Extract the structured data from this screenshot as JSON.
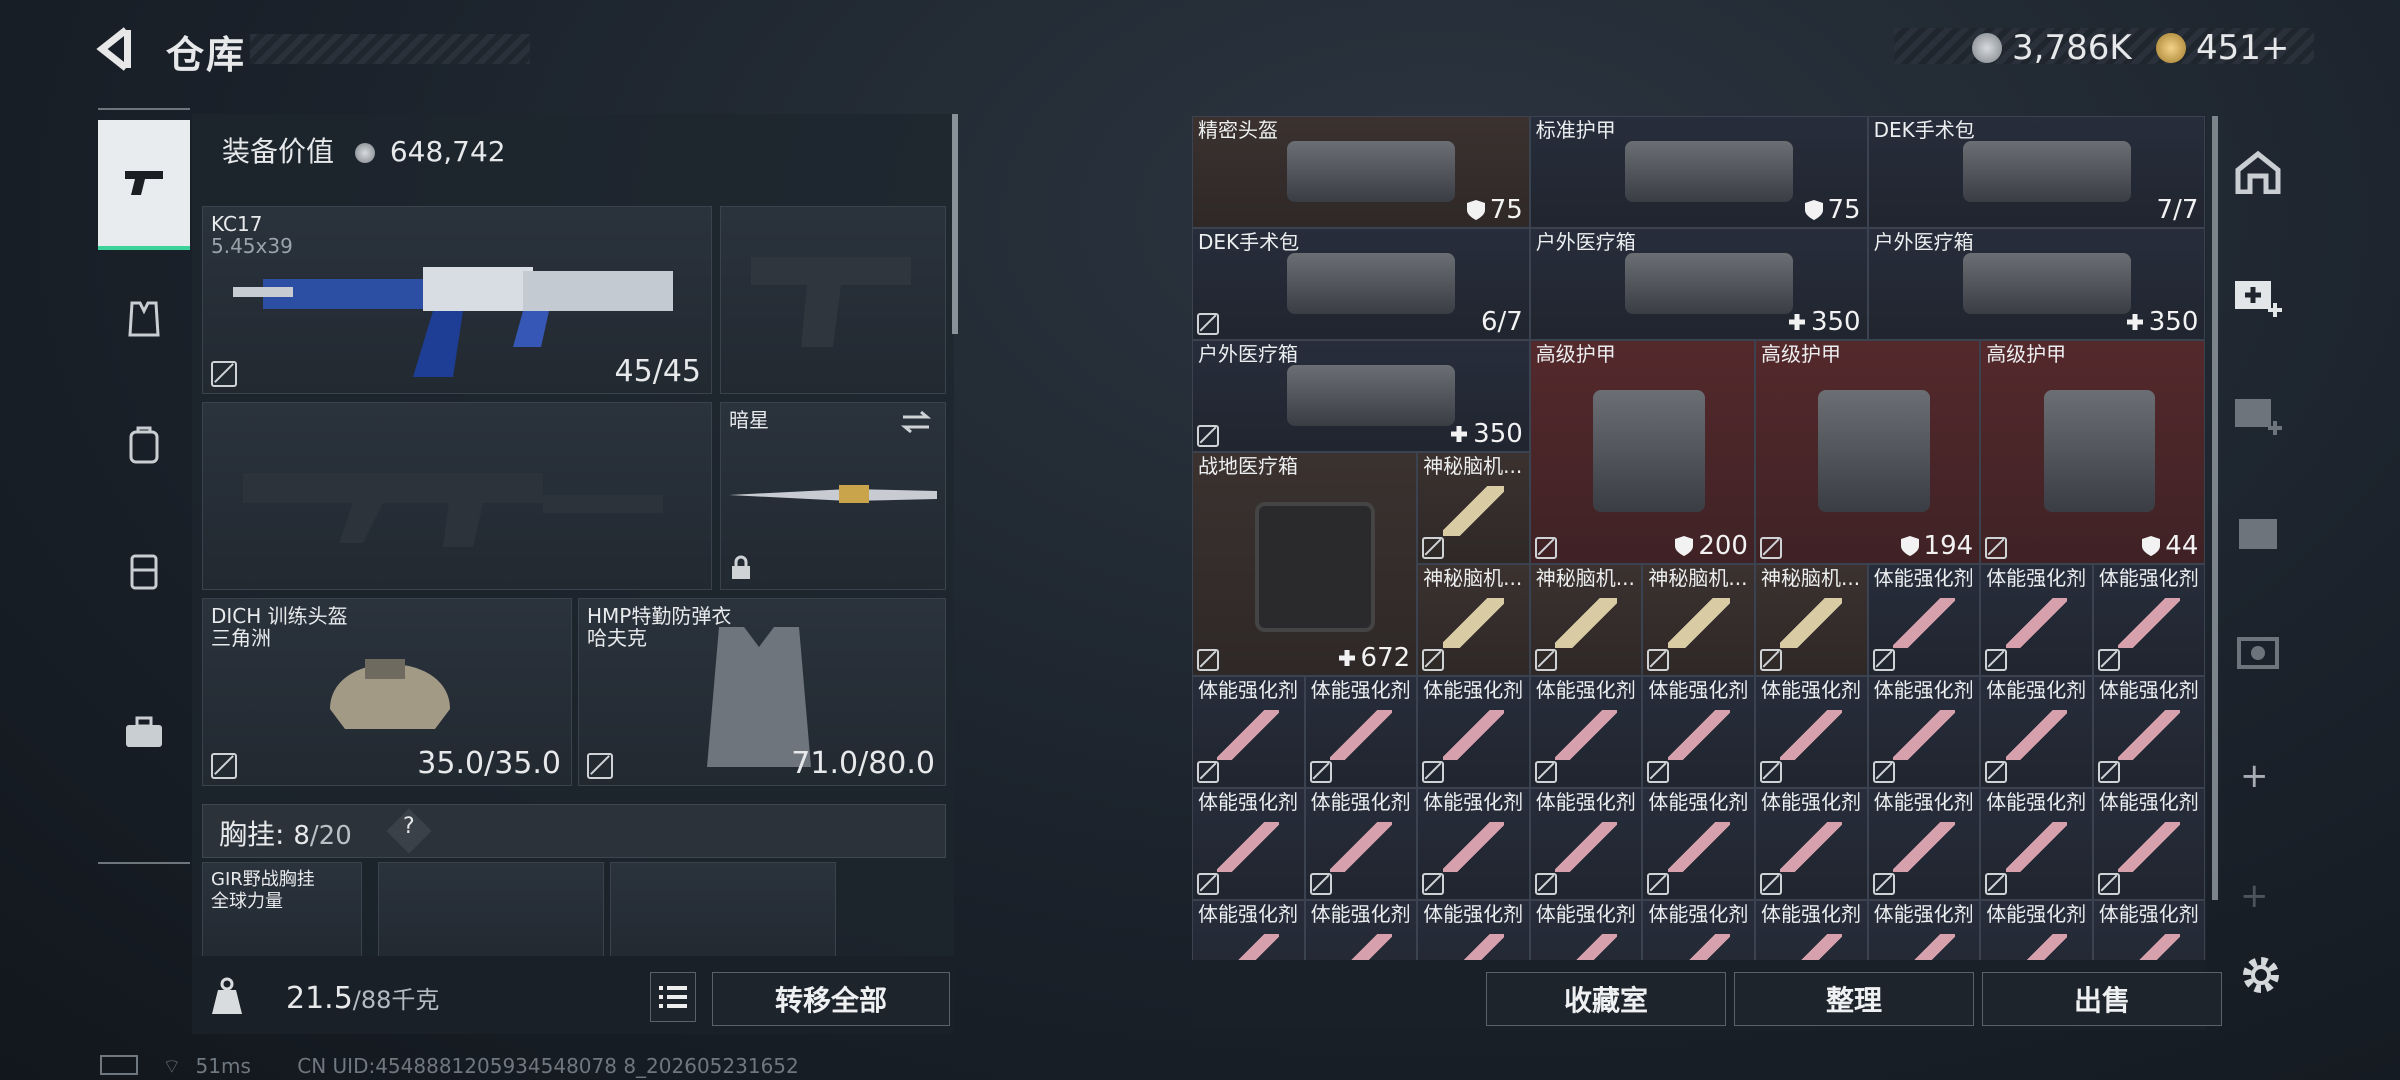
{
  "header": {
    "title": "仓库",
    "silver": "3,786K",
    "gold": "451+"
  },
  "sidebar": [
    "gun-icon",
    "vest-icon",
    "backpack-icon",
    "chest-rig-icon",
    "briefcase-icon"
  ],
  "equipment": {
    "value_label": "装备价值",
    "value": "648,742",
    "primary": {
      "name": "KC17",
      "sub": "5.45x39",
      "ammo": "45/45"
    },
    "melee": {
      "name": "暗星"
    },
    "helmet": {
      "name": "DICH 训练头盔",
      "sub": "三角洲",
      "dur": "35.0/35.0"
    },
    "armor": {
      "name": "HMP特勤防弹衣",
      "sub": "哈夫克",
      "dur": "71.0/80.0"
    },
    "chest_rig": {
      "label": "胸挂:",
      "cur": "8",
      "max": "/20",
      "help": "?",
      "item_name": "GIR野战胸挂",
      "item_sub": "全球力量"
    },
    "weight": {
      "cur": "21.5",
      "max": "/88千克"
    },
    "transfer_all": "转移全部"
  },
  "stash": {
    "items": [
      {
        "name": "精密头盔",
        "qty": "75",
        "qtype": "shield",
        "bg": "brown"
      },
      {
        "name": "标准护甲",
        "qty": "75",
        "qtype": "shield",
        "bg": "blue"
      },
      {
        "name": "DEK手术包",
        "qty": "7/7",
        "qtype": "plain",
        "bg": "blue"
      },
      {
        "name": "DEK手术包",
        "qty": "6/7",
        "qtype": "plain",
        "bg": "blue"
      },
      {
        "name": "户外医疗箱",
        "qty": "350",
        "qtype": "plus",
        "bg": "blue"
      },
      {
        "name": "户外医疗箱",
        "qty": "350",
        "qtype": "plus",
        "bg": "blue"
      },
      {
        "name": "户外医疗箱",
        "qty": "350",
        "qtype": "plus",
        "bg": "blue"
      },
      {
        "name": "高级护甲",
        "qty": "200",
        "qtype": "shield",
        "bg": "red"
      },
      {
        "name": "高级护甲",
        "qty": "194",
        "qtype": "shield",
        "bg": "red"
      },
      {
        "name": "高级护甲",
        "qty": "44",
        "qtype": "shield",
        "bg": "red"
      },
      {
        "name": "战地医疗箱",
        "qty": "672",
        "qtype": "plus",
        "bg": "brown"
      },
      {
        "name": "神秘脑机...",
        "bg": "brown"
      },
      {
        "name": "神秘脑机...",
        "bg": "brown"
      },
      {
        "name": "神秘脑机...",
        "bg": "brown"
      },
      {
        "name": "神秘脑机...",
        "bg": "brown"
      },
      {
        "name": "神秘脑机...",
        "bg": "brown"
      },
      {
        "name": "体能强化剂",
        "bg": "blue"
      }
    ],
    "stimulant": "体能强化剂"
  },
  "buttons": {
    "collection": "收藏室",
    "sort": "整理",
    "sell": "出售"
  },
  "status": {
    "ping": "51ms",
    "uid": "CN UID:4548881205934548078 8_202605231652"
  }
}
